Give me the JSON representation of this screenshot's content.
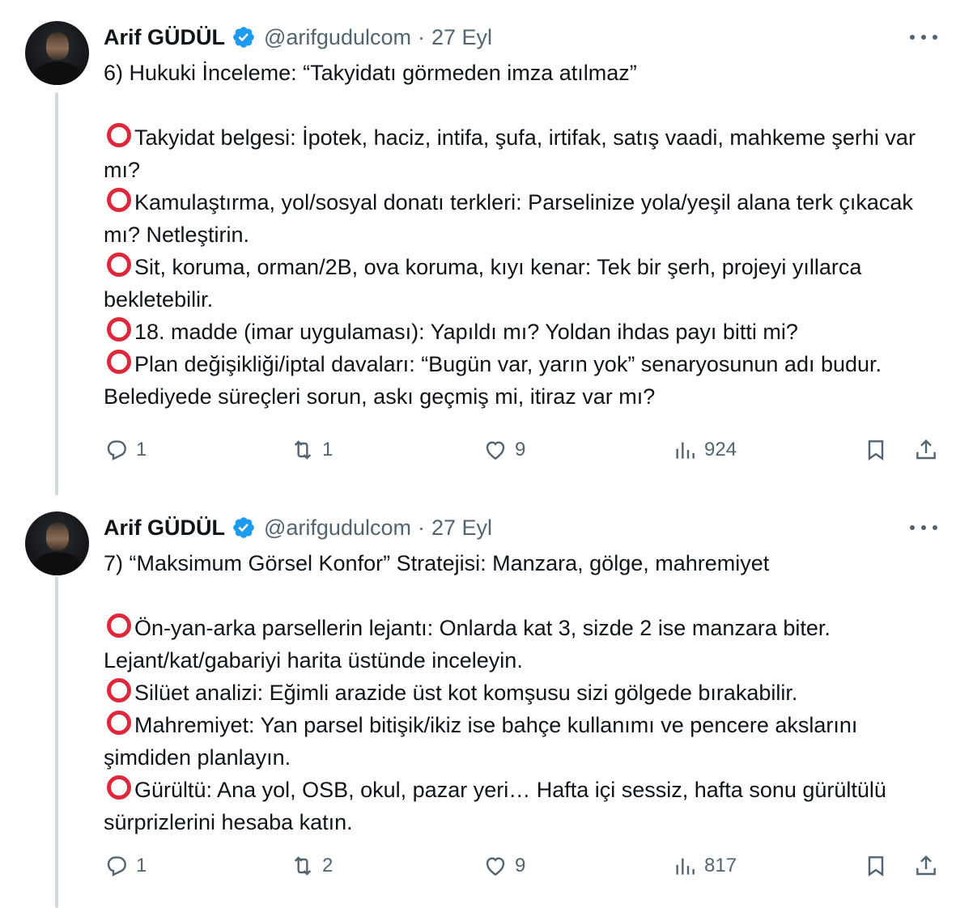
{
  "tweets": [
    {
      "name": "Arif GÜDÜL",
      "handle": "@arifgudulcom",
      "separator": "·",
      "date": "27 Eyl",
      "title": "6) Hukuki İnceleme: “Takyidatı görmeden imza atılmaz”",
      "items": [
        "Takyidat belgesi: İpotek, haciz, intifa, şufa, irtifak, satış vaadi, mahkeme şerhi var mı?",
        "Kamulaştırma, yol/sosyal donatı terkleri: Parselinize yola/yeşil alana terk çıkacak mı? Netleştirin.",
        "Sit, koruma, orman/2B, ova koruma, kıyı kenar: Tek bir şerh, projeyi yıllarca bekletebilir.",
        "18. madde (imar uygulaması): Yapıldı mı? Yoldan ihdas payı bitti mi?",
        "Plan değişikliği/iptal davaları: “Bugün var, yarın yok” senaryosunun adı budur. Belediyede süreçleri sorun, askı geçmiş mi, itiraz var mı?"
      ],
      "replies": "1",
      "retweets": "1",
      "likes": "9",
      "views": "924"
    },
    {
      "name": "Arif GÜDÜL",
      "handle": "@arifgudulcom",
      "separator": "·",
      "date": "27 Eyl",
      "title": "7) “Maksimum Görsel Konfor” Stratejisi: Manzara, gölge, mahremiyet",
      "items": [
        "Ön-yan-arka parsellerin lejantı: Onlarda kat 3, sizde 2 ise manzara biter. Lejant/kat/gabariyi harita üstünde inceleyin.",
        "Silüet analizi: Eğimli arazide üst kot komşusu sizi gölgede bırakabilir.",
        "Mahremiyet: Yan parsel bitişik/ikiz ise bahçe kullanımı ve pencere akslarını şimdiden planlayın.",
        "Gürültü: Ana yol, OSB, okul, pazar yeri… Hafta içi sessiz, hafta sonu gürültülü sürprizlerini hesaba katın."
      ],
      "replies": "1",
      "retweets": "2",
      "likes": "9",
      "views": "817"
    }
  ],
  "colors": {
    "text": "#0f1419",
    "secondary": "#536471",
    "verified": "#1d9bf0",
    "bullet": "#e0283a",
    "thread_line": "#cfd9de"
  },
  "icons": [
    "verified-badge-icon",
    "more-icon",
    "reply-icon",
    "retweet-icon",
    "like-icon",
    "views-icon",
    "bookmark-icon",
    "share-icon",
    "red-circle-icon"
  ]
}
